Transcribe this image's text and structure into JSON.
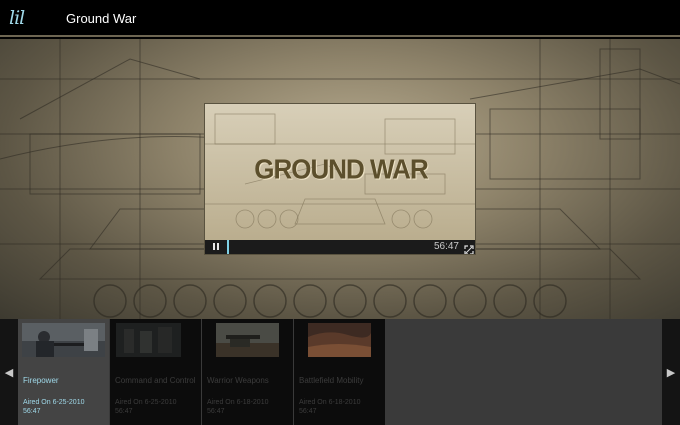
{
  "app": {
    "logo_text": "lil",
    "title": "Ground War"
  },
  "player": {
    "video_title": "GROUND WAR",
    "time": "56:47",
    "progress": 0.01,
    "pause_icon": "pause-icon",
    "fullscreen_icon": "fullscreen-icon"
  },
  "carousel": {
    "items": [
      {
        "title": "Firepower",
        "date": "Aired On 6-25-2010",
        "duration": "56:47",
        "active": true
      },
      {
        "title": "Command and Control",
        "date": "Aired On 6-25-2010",
        "duration": "56:47",
        "active": false
      },
      {
        "title": "Warrior Weapons",
        "date": "Aired On 6-18-2010",
        "duration": "56:47",
        "active": false
      },
      {
        "title": "Battlefield Mobility",
        "date": "Aired On 6-18-2010",
        "duration": "56:47",
        "active": false
      }
    ]
  },
  "colors": {
    "accent": "#9fd8e8",
    "progress": "#7fd1e6"
  }
}
